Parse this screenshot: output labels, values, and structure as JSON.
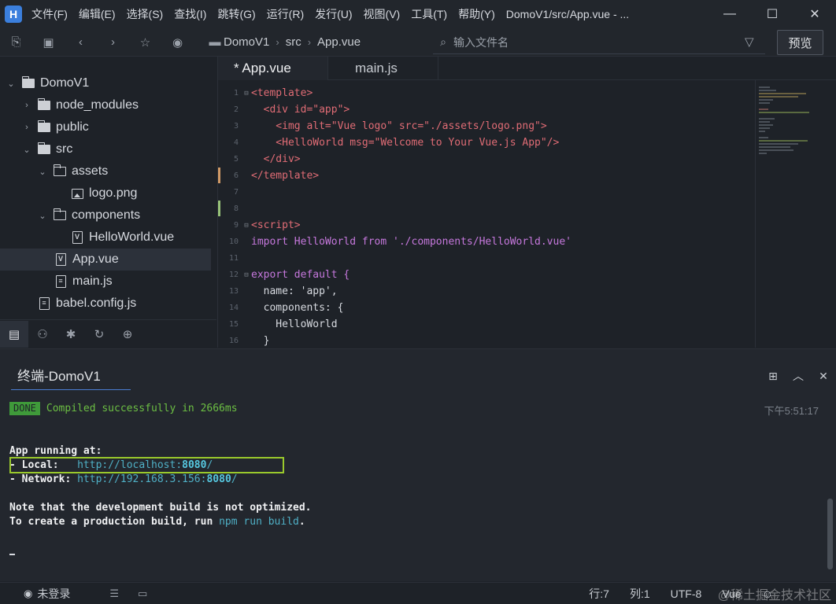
{
  "app": {
    "logo_letter": "H",
    "menu": [
      "文件(F)",
      "编辑(E)",
      "选择(S)",
      "查找(I)",
      "跳转(G)",
      "运行(R)",
      "发行(U)",
      "视图(V)",
      "工具(T)",
      "帮助(Y)"
    ],
    "window_title": "DomoV1/src/App.vue - ..."
  },
  "toolbar": {
    "breadcrumb": [
      "DomoV1",
      "src",
      "App.vue"
    ],
    "search_placeholder": "输入文件名",
    "preview_label": "预览"
  },
  "sidebar": {
    "items": [
      {
        "label": "DomoV1",
        "type": "folder-root",
        "expanded": true,
        "depth": 0
      },
      {
        "label": "node_modules",
        "type": "folder",
        "expanded": false,
        "depth": 1
      },
      {
        "label": "public",
        "type": "folder",
        "expanded": false,
        "depth": 1
      },
      {
        "label": "src",
        "type": "folder",
        "expanded": true,
        "depth": 1
      },
      {
        "label": "assets",
        "type": "folder",
        "expanded": true,
        "depth": 2
      },
      {
        "label": "logo.png",
        "type": "image",
        "depth": 3
      },
      {
        "label": "components",
        "type": "folder",
        "expanded": true,
        "depth": 2
      },
      {
        "label": "HelloWorld.vue",
        "type": "vue",
        "depth": 3
      },
      {
        "label": "App.vue",
        "type": "vue",
        "depth": 2,
        "selected": true
      },
      {
        "label": "main.js",
        "type": "js",
        "depth": 2
      },
      {
        "label": "babel.config.js",
        "type": "js",
        "depth": 1
      }
    ]
  },
  "editor": {
    "tabs": [
      {
        "label": "* App.vue",
        "active": true
      },
      {
        "label": "main.js",
        "active": false
      }
    ],
    "line_numbers": [
      "1",
      "2",
      "3",
      "4",
      "5",
      "6",
      "7",
      "8",
      "9",
      "10",
      "11",
      "12",
      "13",
      "14",
      "15",
      "16"
    ],
    "code": [
      "<template>",
      "  <div id=\"app\">",
      "    <img alt=\"Vue logo\" src=\"./assets/logo.png\">",
      "    <HelloWorld msg=\"Welcome to Your Vue.js App\"/>",
      "  </div>",
      "</template>",
      "",
      "",
      "<script>",
      "import HelloWorld from './components/HelloWorld.vue'",
      "",
      "export default {",
      "  name: 'app',",
      "  components: {",
      "    HelloWorld",
      "  }"
    ]
  },
  "terminal": {
    "tab_label": "终端-DomoV1",
    "done_badge": "DONE",
    "compiled_msg": "Compiled successfully in 2666ms",
    "timestamp": "下午5:51:17",
    "app_running": "App running at:",
    "local_label": "- Local:   ",
    "local_url_prefix": "http://localhost:",
    "local_port": "8080",
    "local_url_suffix": "/",
    "network_label": "- Network: ",
    "network_url_prefix": "http://192.168.3.156:",
    "network_port": "8080",
    "network_url_suffix": "/",
    "note1": "Note that the development build is not optimized.",
    "note2_prefix": "To create a production build, run ",
    "note2_cmd": "npm run build",
    "note2_suffix": "."
  },
  "statusbar": {
    "login": "未登录",
    "cursor_pos": "行:7",
    "col_pos": "列:1",
    "encoding": "UTF-8",
    "language": "Vue",
    "watermark": "@稀土掘金技术社区"
  },
  "colors": {
    "background": "#1e2228",
    "accent": "#4a7dd1",
    "done_green": "#3f9a3a",
    "highlight_box": "#9ac92c"
  }
}
